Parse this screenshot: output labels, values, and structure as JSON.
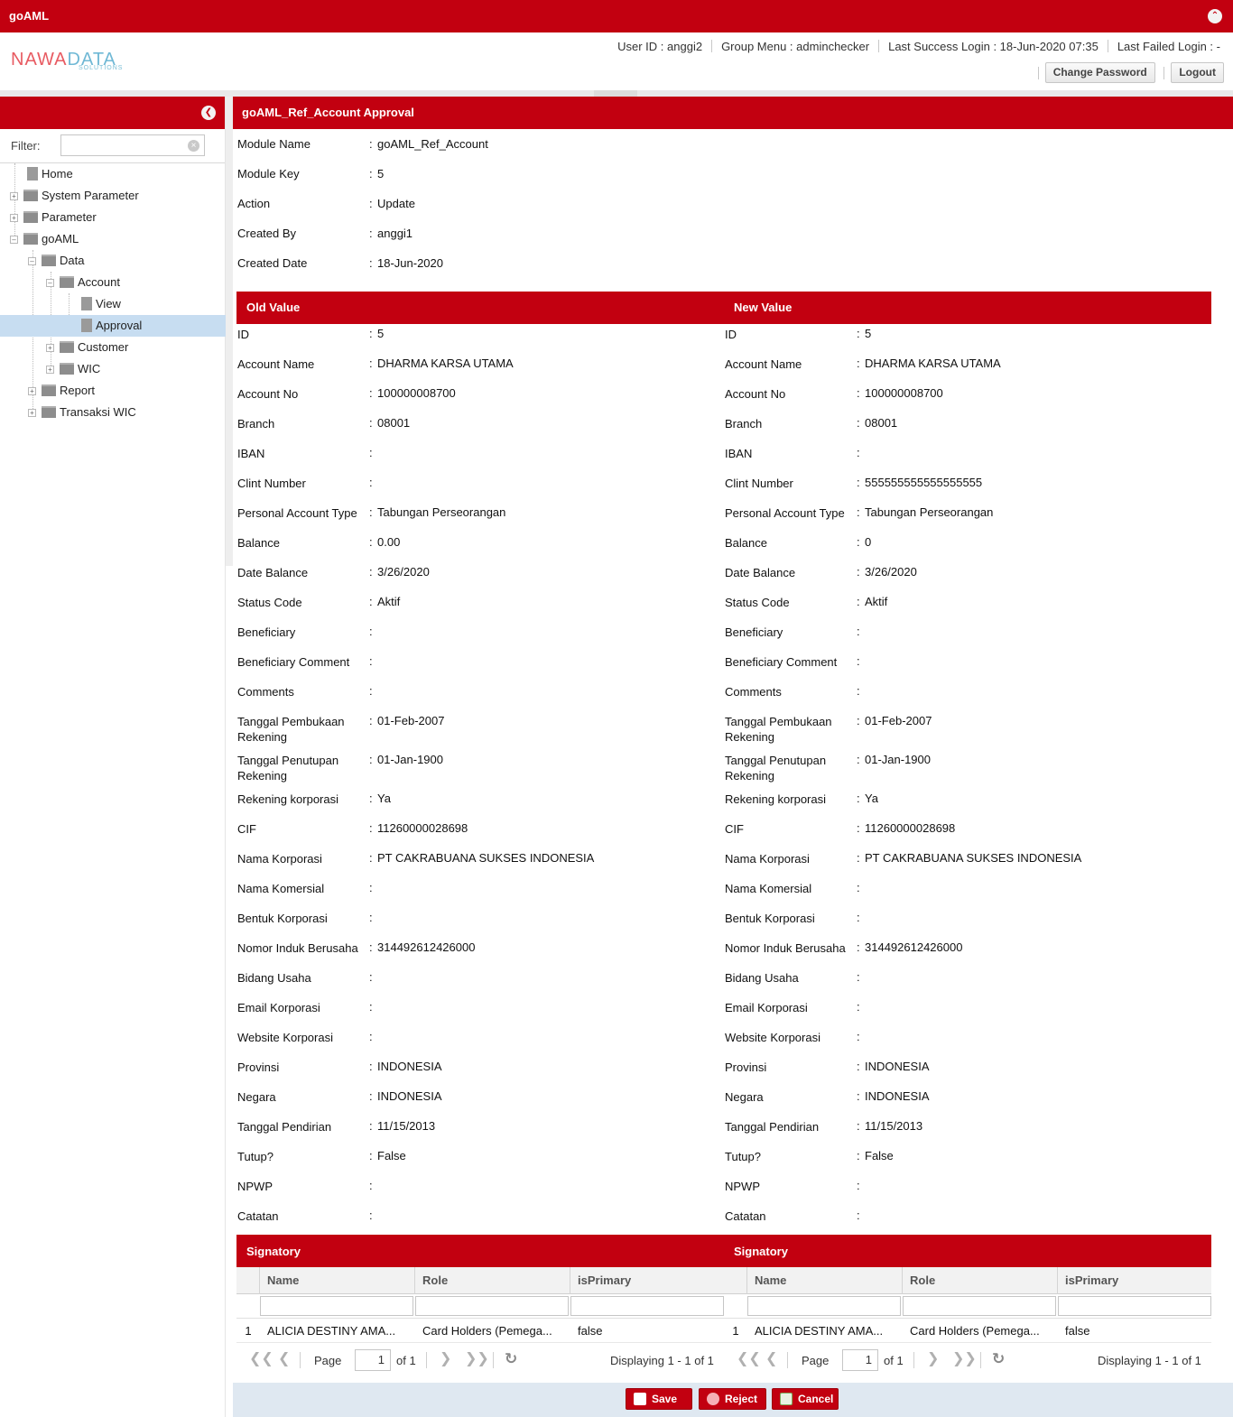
{
  "app": {
    "title": "goAML"
  },
  "logo": {
    "brand": "NAWADATA",
    "tagline": "SOLUTIONS"
  },
  "header": {
    "user_id": "User ID : anggi2",
    "group_menu": "Group Menu : adminchecker",
    "last_success": "Last Success Login : 18-Jun-2020 07:35",
    "last_failed": "Last Failed Login : -",
    "change_password": "Change Password",
    "logout": "Logout"
  },
  "sidebar": {
    "filter_label": "Filter:",
    "filter_value": "",
    "items": [
      {
        "label": "Home"
      },
      {
        "label": "System Parameter"
      },
      {
        "label": "Parameter"
      },
      {
        "label": "goAML"
      },
      {
        "label": "Data"
      },
      {
        "label": "Account"
      },
      {
        "label": "View"
      },
      {
        "label": "Approval"
      },
      {
        "label": "Customer"
      },
      {
        "label": "WIC"
      },
      {
        "label": "Report"
      },
      {
        "label": "Transaksi WIC"
      }
    ]
  },
  "panel": {
    "title": "goAML_Ref_Account Approval",
    "meta": [
      {
        "key": "Module Name",
        "value": "goAML_Ref_Account"
      },
      {
        "key": "Module Key",
        "value": "5"
      },
      {
        "key": "Action",
        "value": "Update"
      },
      {
        "key": "Created By",
        "value": "anggi1"
      },
      {
        "key": "Created Date",
        "value": "18-Jun-2020"
      }
    ]
  },
  "compare": {
    "old_title": "Old Value",
    "new_title": "New Value",
    "fields": [
      {
        "key": "ID",
        "old": "5",
        "new": "5"
      },
      {
        "key": "Account Name",
        "old": "DHARMA KARSA UTAMA",
        "new": "DHARMA KARSA UTAMA"
      },
      {
        "key": "Account No",
        "old": "100000008700",
        "new": "100000008700"
      },
      {
        "key": "Branch",
        "old": "08001",
        "new": "08001"
      },
      {
        "key": "IBAN",
        "old": "",
        "new": ""
      },
      {
        "key": "Clint Number",
        "old": "",
        "new": "555555555555555555"
      },
      {
        "key": "Personal Account Type",
        "old": "Tabungan Perseorangan",
        "new": "Tabungan Perseorangan"
      },
      {
        "key": "Balance",
        "old": "0.00",
        "new": "0"
      },
      {
        "key": "Date Balance",
        "old": "3/26/2020",
        "new": "3/26/2020"
      },
      {
        "key": "Status Code",
        "old": "Aktif",
        "new": "Aktif"
      },
      {
        "key": "Beneficiary",
        "old": "",
        "new": ""
      },
      {
        "key": "Beneficiary Comment",
        "old": "",
        "new": ""
      },
      {
        "key": "Comments",
        "old": "",
        "new": ""
      },
      {
        "key": "Tanggal Pembukaan Rekening",
        "old": "01-Feb-2007",
        "new": "01-Feb-2007"
      },
      {
        "key": "Tanggal Penutupan Rekening",
        "old": "01-Jan-1900",
        "new": "01-Jan-1900"
      },
      {
        "key": "Rekening korporasi",
        "old": "Ya",
        "new": "Ya"
      },
      {
        "key": "CIF",
        "old": "11260000028698",
        "new": "11260000028698"
      },
      {
        "key": "Nama Korporasi",
        "old": "PT CAKRABUANA SUKSES INDONESIA",
        "new": "PT CAKRABUANA SUKSES INDONESIA"
      },
      {
        "key": "Nama Komersial",
        "old": "",
        "new": ""
      },
      {
        "key": "Bentuk Korporasi",
        "old": "",
        "new": ""
      },
      {
        "key": "Nomor Induk Berusaha",
        "old": "314492612426000",
        "new": "314492612426000"
      },
      {
        "key": "Bidang Usaha",
        "old": "",
        "new": ""
      },
      {
        "key": "Email Korporasi",
        "old": "",
        "new": ""
      },
      {
        "key": "Website Korporasi",
        "old": "",
        "new": ""
      },
      {
        "key": "Provinsi",
        "old": "INDONESIA",
        "new": "INDONESIA"
      },
      {
        "key": "Negara",
        "old": "INDONESIA",
        "new": "INDONESIA"
      },
      {
        "key": "Tanggal Pendirian",
        "old": "11/15/2013",
        "new": "11/15/2013"
      },
      {
        "key": "Tutup?",
        "old": "False",
        "new": "False"
      },
      {
        "key": "NPWP",
        "old": "",
        "new": ""
      },
      {
        "key": "Catatan",
        "old": "",
        "new": ""
      }
    ]
  },
  "signatory": {
    "title": "Signatory",
    "columns": [
      "Name",
      "Role",
      "isPrimary"
    ],
    "old_rows": [
      {
        "num": "1",
        "name": "ALICIA DESTINY AMA...",
        "role": "Card Holders (Pemega...",
        "primary": "false"
      }
    ],
    "new_rows": [
      {
        "num": "1",
        "name": "ALICIA DESTINY AMA...",
        "role": "Card Holders (Pemega...",
        "primary": "false"
      }
    ],
    "pager": {
      "page_label": "Page",
      "page_value": "1",
      "of": "of 1",
      "displaying": "Displaying 1 - 1 of 1"
    }
  },
  "footer": {
    "save": "Save",
    "reject": "Reject",
    "cancel": "Cancel"
  },
  "colors": {
    "brand": "#c20010",
    "selected": "#c7ddf1",
    "footer": "#dfe8f1"
  },
  "icons": [
    "collapse-up-icon",
    "collapse-left-icon",
    "clear-icon",
    "folder-icon",
    "file-icon",
    "first-page-icon",
    "prev-page-icon",
    "next-page-icon",
    "last-page-icon",
    "refresh-icon",
    "save-icon",
    "reject-icon",
    "cancel-icon"
  ]
}
